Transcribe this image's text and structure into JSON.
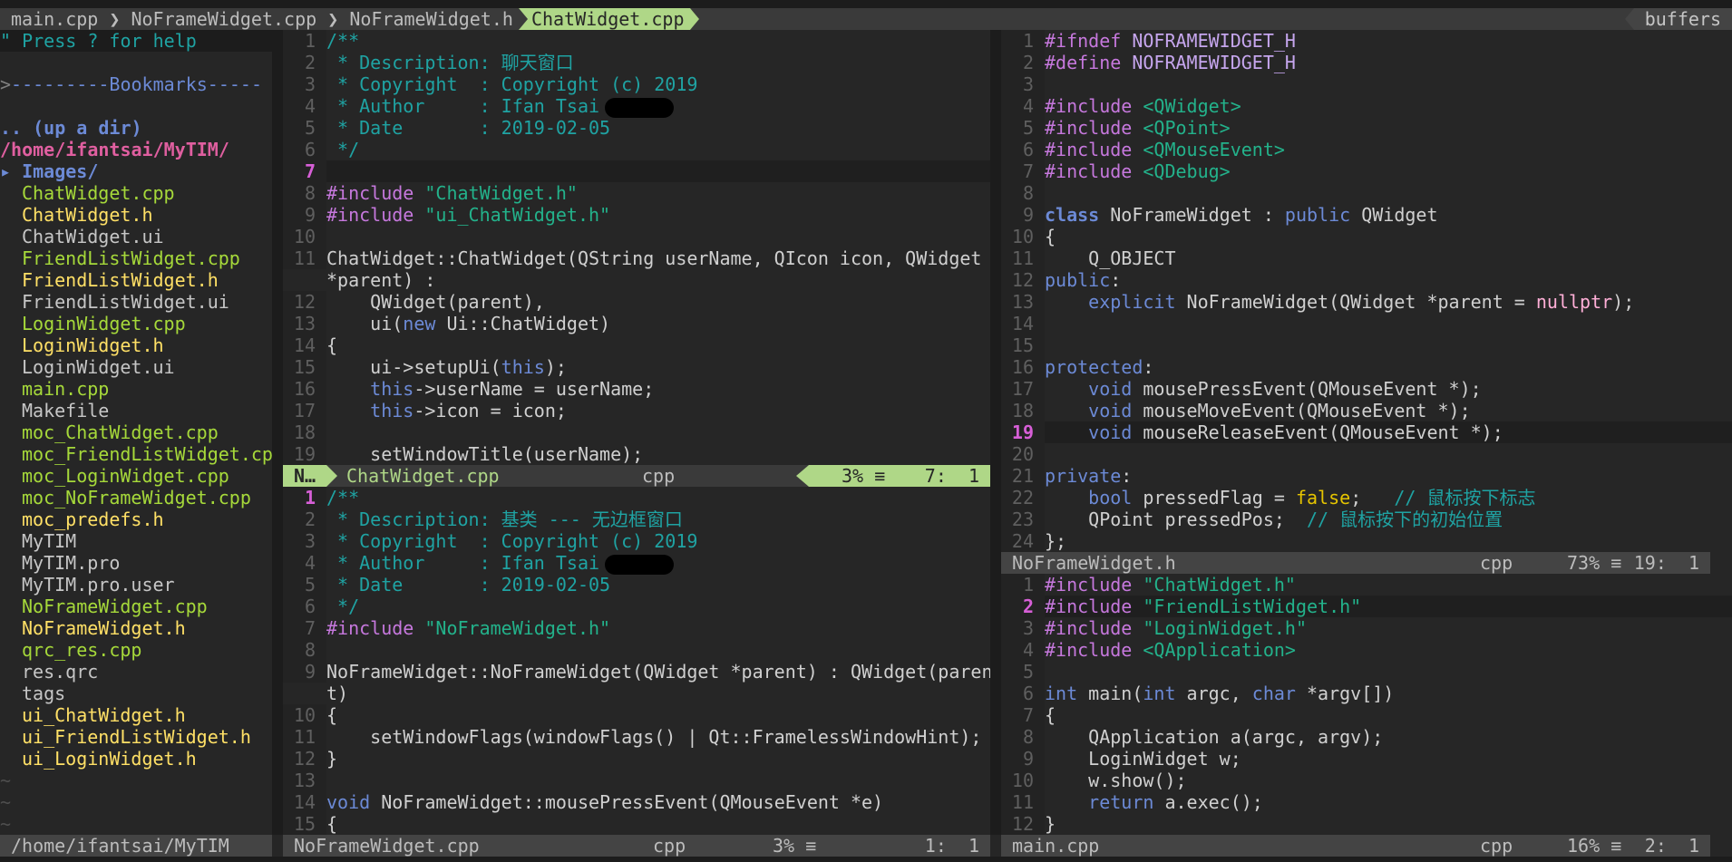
{
  "colors": {
    "background": "#262626",
    "accent_green": "#afd787",
    "comment": "#1fa3a3",
    "preproc": "#c678dd",
    "string": "#23b28b",
    "keyword": "#6c8ad6"
  },
  "tabline": {
    "separator": "❯",
    "tabs": [
      {
        "label": "main.cpp",
        "active": false
      },
      {
        "label": "NoFrameWidget.cpp",
        "active": false
      },
      {
        "label": "NoFrameWidget.h",
        "active": false
      },
      {
        "label": "ChatWidget.cpp",
        "active": true
      }
    ],
    "buffers_label": "buffers"
  },
  "tree": {
    "help": "\" Press ? for help",
    "bookmarks_prefix": ">",
    "bookmarks": "---------Bookmarks-----",
    "updir": ".. (up a dir)",
    "path": "/home/ifantsai/MyTIM/",
    "dir_icon": "triangle-right-icon",
    "dir": "Images/",
    "items": [
      {
        "name": "ChatWidget.cpp",
        "type": "cpp"
      },
      {
        "name": "ChatWidget.h",
        "type": "h"
      },
      {
        "name": "ChatWidget.ui",
        "type": "other"
      },
      {
        "name": "FriendListWidget.cpp",
        "type": "cpp"
      },
      {
        "name": "FriendListWidget.h",
        "type": "h"
      },
      {
        "name": "FriendListWidget.ui",
        "type": "other"
      },
      {
        "name": "LoginWidget.cpp",
        "type": "cpp"
      },
      {
        "name": "LoginWidget.h",
        "type": "h"
      },
      {
        "name": "LoginWidget.ui",
        "type": "other"
      },
      {
        "name": "main.cpp",
        "type": "cpp"
      },
      {
        "name": "Makefile",
        "type": "other"
      },
      {
        "name": "moc_ChatWidget.cpp",
        "type": "cpp"
      },
      {
        "name": "moc_FriendListWidget.cp",
        "type": "cpp"
      },
      {
        "name": "moc_LoginWidget.cpp",
        "type": "cpp"
      },
      {
        "name": "moc_NoFrameWidget.cpp",
        "type": "cpp"
      },
      {
        "name": "moc_predefs.h",
        "type": "h"
      },
      {
        "name": "MyTIM",
        "type": "other"
      },
      {
        "name": "MyTIM.pro",
        "type": "other"
      },
      {
        "name": "MyTIM.pro.user",
        "type": "other"
      },
      {
        "name": "NoFrameWidget.cpp",
        "type": "cpp"
      },
      {
        "name": "NoFrameWidget.h",
        "type": "h"
      },
      {
        "name": "qrc_res.cpp",
        "type": "cpp"
      },
      {
        "name": "res.qrc",
        "type": "other"
      },
      {
        "name": "tags",
        "type": "other"
      },
      {
        "name": "ui_ChatWidget.h",
        "type": "h"
      },
      {
        "name": "ui_FriendListWidget.h",
        "type": "h"
      },
      {
        "name": "ui_LoginWidget.h",
        "type": "h"
      }
    ],
    "tildes": [
      "~",
      "~",
      "~"
    ],
    "status": "/home/ifantsai/MyTIM"
  },
  "panes": {
    "chat": {
      "rows": [
        {
          "n": "1",
          "t": [
            [
              "/**",
              "c"
            ]
          ]
        },
        {
          "n": "2",
          "t": [
            [
              " * Description: 聊天窗口",
              "c"
            ]
          ]
        },
        {
          "n": "3",
          "t": [
            [
              " * Copyright  : Copyright (c) 2019",
              "c"
            ]
          ]
        },
        {
          "n": "4",
          "t": [
            [
              " * Author     : Ifan Tsai",
              "c"
            ]
          ],
          "redacted": true
        },
        {
          "n": "5",
          "t": [
            [
              " * Date       : 2019-02-05",
              "c"
            ]
          ]
        },
        {
          "n": "6",
          "t": [
            [
              " */",
              "c"
            ]
          ]
        },
        {
          "n": "7",
          "t": [],
          "cur": true,
          "hl": true
        },
        {
          "n": "8",
          "t": [
            [
              "#include",
              "p"
            ],
            [
              " ",
              ""
            ],
            [
              "\"ChatWidget.h\"",
              "s"
            ]
          ]
        },
        {
          "n": "9",
          "t": [
            [
              "#include",
              "p"
            ],
            [
              " ",
              ""
            ],
            [
              "\"ui_ChatWidget.h\"",
              "s"
            ]
          ]
        },
        {
          "n": "10",
          "t": []
        },
        {
          "n": "11",
          "t": [
            [
              "ChatWidget::ChatWidget(QString userName, QIcon icon, QWidget",
              ""
            ]
          ]
        },
        {
          "n": "",
          "t": [
            [
              "*parent) :",
              ""
            ]
          ]
        },
        {
          "n": "12",
          "t": [
            [
              "    QWidget(parent),",
              ""
            ]
          ]
        },
        {
          "n": "13",
          "t": [
            [
              "    ui(",
              ""
            ],
            [
              "new",
              "k"
            ],
            [
              " Ui::ChatWidget)",
              ""
            ]
          ]
        },
        {
          "n": "14",
          "t": [
            [
              "{",
              ""
            ]
          ]
        },
        {
          "n": "15",
          "t": [
            [
              "    ui->setupUi(",
              ""
            ],
            [
              "this",
              "k"
            ],
            [
              ");",
              ""
            ]
          ]
        },
        {
          "n": "16",
          "t": [
            [
              "    ",
              ""
            ],
            [
              "this",
              "k"
            ],
            [
              "->userName = userName;",
              ""
            ]
          ]
        },
        {
          "n": "17",
          "t": [
            [
              "    ",
              ""
            ],
            [
              "this",
              "k"
            ],
            [
              "->icon = icon;",
              ""
            ]
          ]
        },
        {
          "n": "18",
          "t": []
        },
        {
          "n": "19",
          "t": [
            [
              "    setWindowTitle(userName);",
              ""
            ]
          ]
        }
      ],
      "status": {
        "mode": "N…",
        "file": "ChatWidget.cpp",
        "filetype": "cpp",
        "percent": "3% ≡",
        "position": "7:  1"
      }
    },
    "noframe_cpp": {
      "rows": [
        {
          "n": "1",
          "t": [
            [
              "/**",
              "c"
            ]
          ],
          "hl": true
        },
        {
          "n": "2",
          "t": [
            [
              " * Description: 基类 --- 无边框窗口",
              "c"
            ]
          ]
        },
        {
          "n": "3",
          "t": [
            [
              " * Copyright  : Copyright (c) 2019",
              "c"
            ]
          ]
        },
        {
          "n": "4",
          "t": [
            [
              " * Author     : Ifan Tsai",
              "c"
            ]
          ],
          "redacted": true
        },
        {
          "n": "5",
          "t": [
            [
              " * Date       : 2019-02-05",
              "c"
            ]
          ]
        },
        {
          "n": "6",
          "t": [
            [
              " */",
              "c"
            ]
          ]
        },
        {
          "n": "7",
          "t": [
            [
              "#include",
              "p"
            ],
            [
              " ",
              ""
            ],
            [
              "\"NoFrameWidget.h\"",
              "s"
            ]
          ]
        },
        {
          "n": "8",
          "t": []
        },
        {
          "n": "9",
          "t": [
            [
              "NoFrameWidget::NoFrameWidget(QWidget *parent) : QWidget(paren",
              ""
            ]
          ]
        },
        {
          "n": "",
          "t": [
            [
              "t)",
              ""
            ]
          ]
        },
        {
          "n": "10",
          "t": [
            [
              "{",
              ""
            ]
          ]
        },
        {
          "n": "11",
          "t": [
            [
              "    setWindowFlags(windowFlags() | Qt::FramelessWindowHint);",
              ""
            ]
          ]
        },
        {
          "n": "12",
          "t": [
            [
              "}",
              ""
            ]
          ]
        },
        {
          "n": "13",
          "t": []
        },
        {
          "n": "14",
          "t": [
            [
              "void",
              "k"
            ],
            [
              " NoFrameWidget::mousePressEvent(QMouseEvent *e)",
              ""
            ]
          ]
        },
        {
          "n": "15",
          "t": [
            [
              "{",
              ""
            ]
          ]
        }
      ],
      "status": {
        "file": "NoFrameWidget.cpp",
        "filetype": "cpp",
        "percent": "3% ≡",
        "position": "1:  1"
      }
    },
    "noframe_h": {
      "rows": [
        {
          "n": "1",
          "t": [
            [
              "#ifndef",
              "p"
            ],
            [
              " NOFRAMEWIDGET_H",
              "d"
            ]
          ]
        },
        {
          "n": "2",
          "t": [
            [
              "#define",
              "p"
            ],
            [
              " NOFRAMEWIDGET_H",
              "d"
            ]
          ]
        },
        {
          "n": "3",
          "t": []
        },
        {
          "n": "4",
          "t": [
            [
              "#include",
              "p"
            ],
            [
              " ",
              ""
            ],
            [
              "<QWidget>",
              "s"
            ]
          ]
        },
        {
          "n": "5",
          "t": [
            [
              "#include",
              "p"
            ],
            [
              " ",
              ""
            ],
            [
              "<QPoint>",
              "s"
            ]
          ]
        },
        {
          "n": "6",
          "t": [
            [
              "#include",
              "p"
            ],
            [
              " ",
              ""
            ],
            [
              "<QMouseEvent>",
              "s"
            ]
          ]
        },
        {
          "n": "7",
          "t": [
            [
              "#include",
              "p"
            ],
            [
              " ",
              ""
            ],
            [
              "<QDebug>",
              "s"
            ]
          ]
        },
        {
          "n": "8",
          "t": []
        },
        {
          "n": "9",
          "t": [
            [
              "class",
              "kb"
            ],
            [
              " NoFrameWidget : ",
              ""
            ],
            [
              "public",
              "k"
            ],
            [
              " QWidget",
              ""
            ]
          ]
        },
        {
          "n": "10",
          "t": [
            [
              "{",
              ""
            ]
          ]
        },
        {
          "n": "11",
          "t": [
            [
              "    Q_OBJECT",
              ""
            ]
          ]
        },
        {
          "n": "12",
          "t": [
            [
              "public",
              "k"
            ],
            [
              ":",
              ""
            ]
          ]
        },
        {
          "n": "13",
          "t": [
            [
              "    ",
              ""
            ],
            [
              "explicit",
              "k"
            ],
            [
              " NoFrameWidget(QWidget *parent = ",
              ""
            ],
            [
              "nullptr",
              "m"
            ],
            [
              ");",
              ""
            ]
          ]
        },
        {
          "n": "14",
          "t": []
        },
        {
          "n": "15",
          "t": []
        },
        {
          "n": "16",
          "t": [
            [
              "protected",
              "k"
            ],
            [
              ":",
              ""
            ]
          ]
        },
        {
          "n": "17",
          "t": [
            [
              "    ",
              ""
            ],
            [
              "void",
              "k"
            ],
            [
              " mousePressEvent(QMouseEvent *);",
              ""
            ]
          ]
        },
        {
          "n": "18",
          "t": [
            [
              "    ",
              ""
            ],
            [
              "void",
              "k"
            ],
            [
              " mouseMoveEvent(QMouseEvent *);",
              ""
            ]
          ]
        },
        {
          "n": "19",
          "t": [
            [
              "    ",
              ""
            ],
            [
              "void",
              "k"
            ],
            [
              " mouseReleaseEvent(QMouseEvent *);",
              ""
            ]
          ],
          "cur": true,
          "hl": true
        },
        {
          "n": "20",
          "t": []
        },
        {
          "n": "21",
          "t": [
            [
              "private",
              "k"
            ],
            [
              ":",
              ""
            ]
          ]
        },
        {
          "n": "22",
          "t": [
            [
              "    ",
              ""
            ],
            [
              "bool",
              "k"
            ],
            [
              " pressedFlag = ",
              ""
            ],
            [
              "false",
              "y"
            ],
            [
              ";   ",
              ""
            ],
            [
              "// 鼠标按下标志",
              "c"
            ]
          ]
        },
        {
          "n": "23",
          "t": [
            [
              "    QPoint pressedPos;  ",
              ""
            ],
            [
              "// 鼠标按下的初始位置",
              "c"
            ]
          ]
        },
        {
          "n": "24",
          "t": [
            [
              "};",
              ""
            ]
          ]
        }
      ],
      "status": {
        "file": "NoFrameWidget.h",
        "filetype": "cpp",
        "percent": "73% ≡",
        "position": "19:  1"
      }
    },
    "main": {
      "rows": [
        {
          "n": "1",
          "t": [
            [
              "#include",
              "p"
            ],
            [
              " ",
              ""
            ],
            [
              "\"ChatWidget.h\"",
              "s"
            ]
          ]
        },
        {
          "n": "2",
          "t": [
            [
              "#include",
              "p"
            ],
            [
              " ",
              ""
            ],
            [
              "\"FriendListWidget.h\"",
              "s"
            ]
          ],
          "cur": true,
          "hl": true
        },
        {
          "n": "3",
          "t": [
            [
              "#include",
              "p"
            ],
            [
              " ",
              ""
            ],
            [
              "\"LoginWidget.h\"",
              "s"
            ]
          ]
        },
        {
          "n": "4",
          "t": [
            [
              "#include",
              "p"
            ],
            [
              " ",
              ""
            ],
            [
              "<QApplication>",
              "s"
            ]
          ]
        },
        {
          "n": "5",
          "t": []
        },
        {
          "n": "6",
          "t": [
            [
              "int",
              "k"
            ],
            [
              " main(",
              ""
            ],
            [
              "int",
              "k"
            ],
            [
              " argc, ",
              ""
            ],
            [
              "char",
              "k"
            ],
            [
              " *argv[])",
              ""
            ]
          ]
        },
        {
          "n": "7",
          "t": [
            [
              "{",
              ""
            ]
          ]
        },
        {
          "n": "8",
          "t": [
            [
              "    QApplication a(argc, argv);",
              ""
            ]
          ]
        },
        {
          "n": "9",
          "t": [
            [
              "    LoginWidget w;",
              ""
            ]
          ]
        },
        {
          "n": "10",
          "t": [
            [
              "    w.show();",
              ""
            ]
          ]
        },
        {
          "n": "11",
          "t": [
            [
              "    ",
              ""
            ],
            [
              "return",
              "k"
            ],
            [
              " a.exec();",
              ""
            ]
          ]
        },
        {
          "n": "12",
          "t": [
            [
              "}",
              ""
            ]
          ]
        }
      ],
      "status": {
        "file": "main.cpp",
        "filetype": "cpp",
        "percent": "16% ≡",
        "position": "2:  1"
      }
    }
  }
}
